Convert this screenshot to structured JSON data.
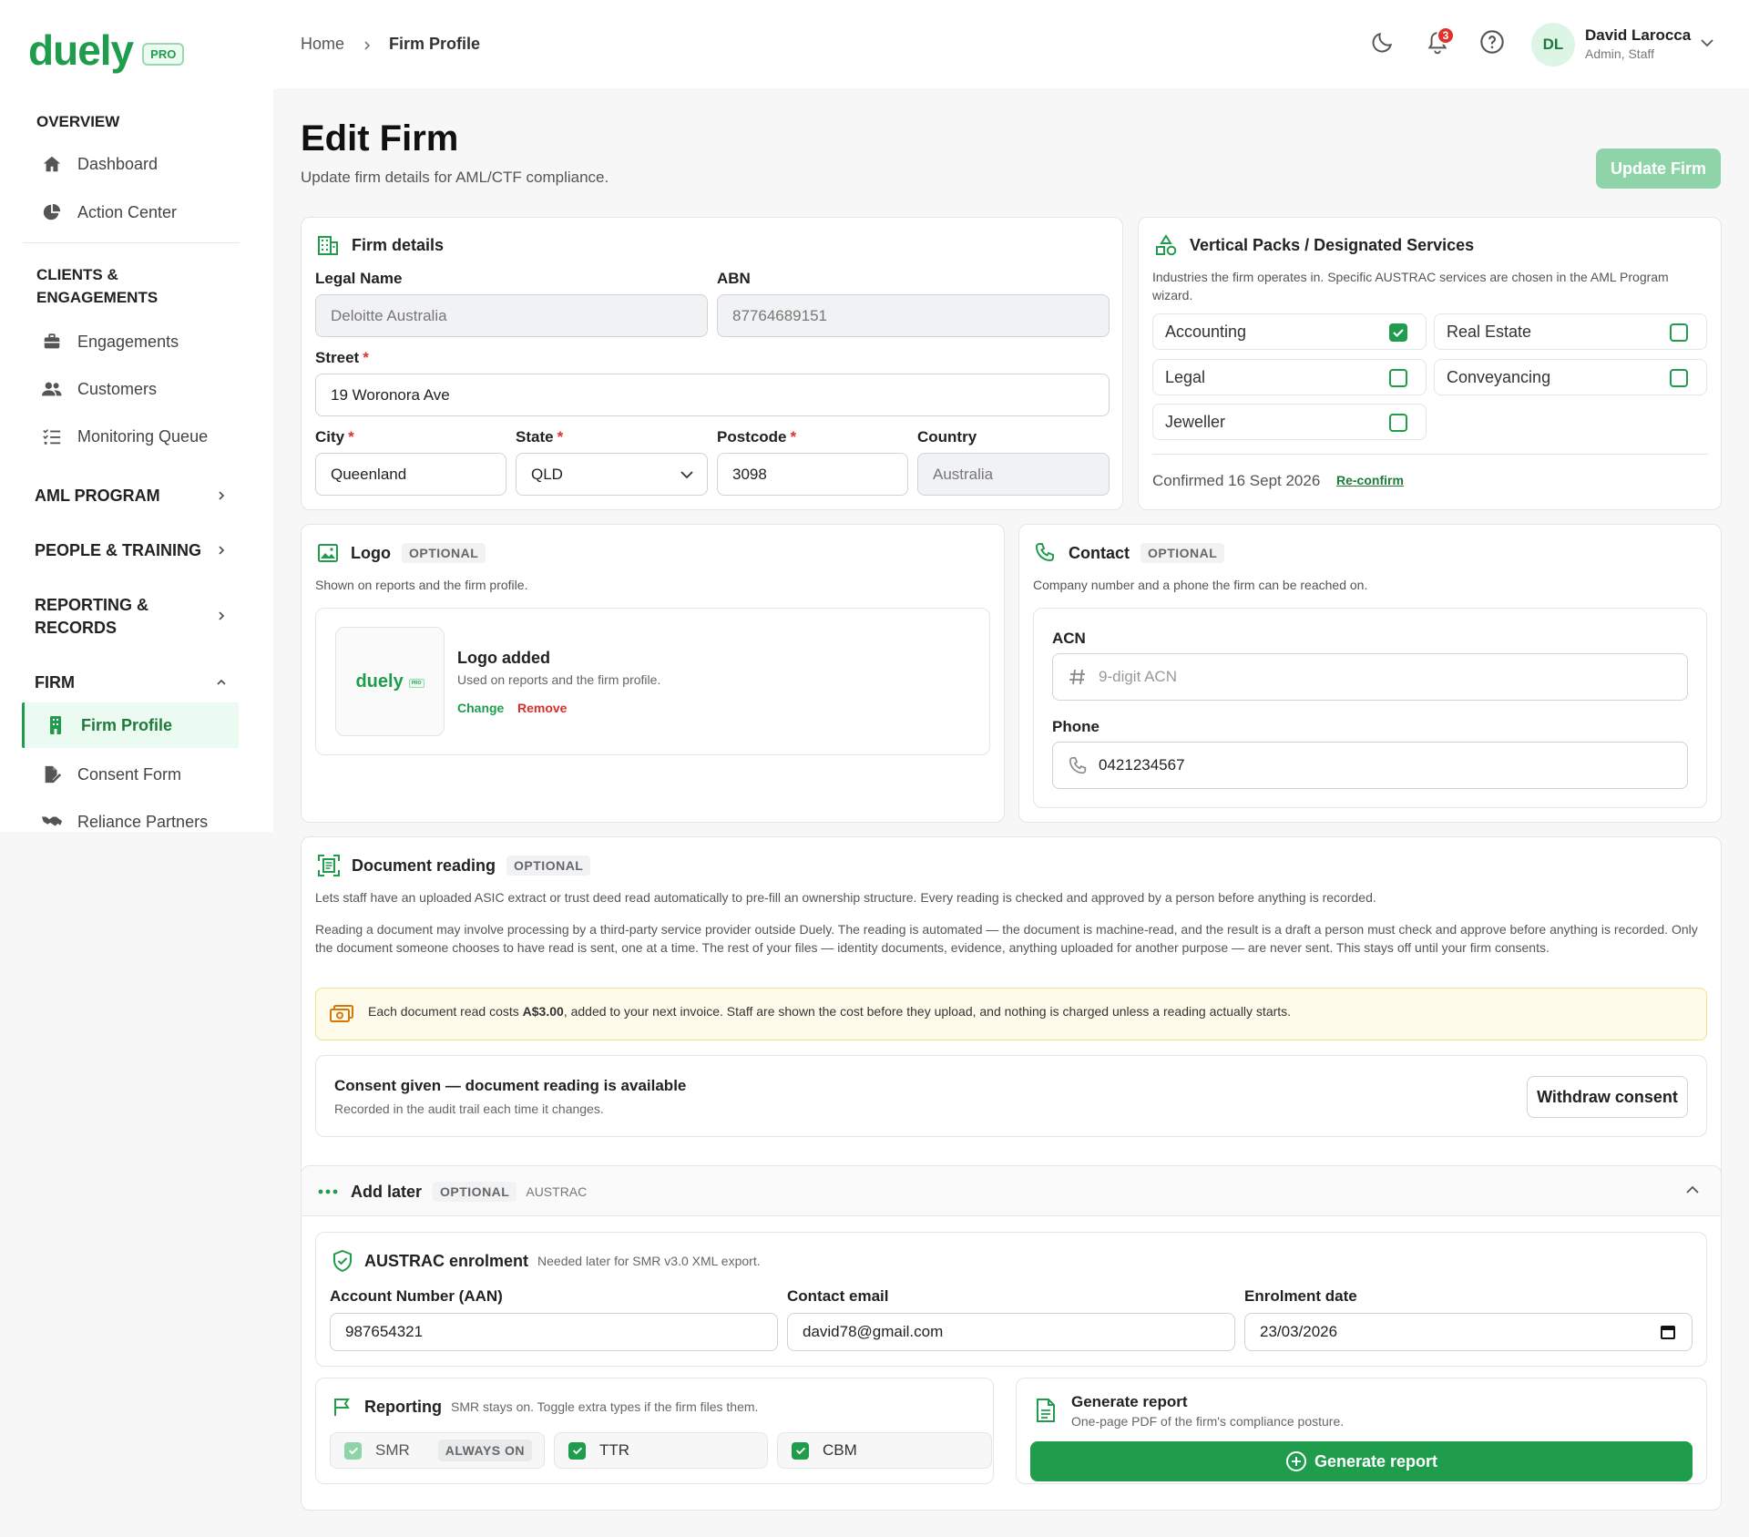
{
  "brand": {
    "name": "duely",
    "badge": "PRO"
  },
  "sidebar": {
    "sections": {
      "overview": "OVERVIEW",
      "clients": "CLIENTS &\nENGAGEMENTS",
      "aml": "AML PROGRAM",
      "people": "PEOPLE & TRAINING",
      "reporting": "REPORTING &\nRECORDS",
      "firm": "FIRM"
    },
    "items": {
      "dashboard": "Dashboard",
      "action_center": "Action Center",
      "engagements": "Engagements",
      "customers": "Customers",
      "monitoring": "Monitoring Queue",
      "firm_profile": "Firm Profile",
      "consent_form": "Consent Form",
      "reliance": "Reliance Partners"
    }
  },
  "header": {
    "breadcrumb": {
      "home": "Home",
      "current": "Firm Profile"
    },
    "notifications": "3",
    "user": {
      "initials": "DL",
      "name": "David Larocca",
      "role": "Admin, Staff"
    }
  },
  "page": {
    "title": "Edit Firm",
    "subtitle": "Update firm details for AML/CTF compliance.",
    "update_button": "Update Firm"
  },
  "firm_details": {
    "title": "Firm details",
    "legal_name_label": "Legal Name",
    "legal_name": "Deloitte Australia",
    "abn_label": "ABN",
    "abn": "87764689151",
    "street_label": "Street",
    "street": "19 Woronora Ave",
    "city_label": "City",
    "city": "Queenland",
    "state_label": "State",
    "state": "QLD",
    "postcode_label": "Postcode",
    "postcode": "3098",
    "country_label": "Country",
    "country": "Australia",
    "required_mark": "*"
  },
  "vertical": {
    "title": "Vertical Packs / Designated Services",
    "desc": "Industries the firm operates in. Specific AUSTRAC services are chosen in the AML Program wizard.",
    "options": {
      "accounting": "Accounting",
      "real_estate": "Real Estate",
      "legal": "Legal",
      "conveyancing": "Conveyancing",
      "jeweller": "Jeweller"
    },
    "checked": {
      "accounting": true,
      "real_estate": false,
      "legal": false,
      "conveyancing": false,
      "jeweller": false
    },
    "confirmed": "Confirmed 16 Sept 2026",
    "reconfirm": "Re-confirm"
  },
  "logo_card": {
    "title": "Logo",
    "optional": "OPTIONAL",
    "desc": "Shown on reports and the firm profile.",
    "added": "Logo added",
    "added_desc": "Used on reports and the firm profile.",
    "change": "Change",
    "remove": "Remove",
    "thumb_word": "duely",
    "thumb_badge": "PRO"
  },
  "contact": {
    "title": "Contact",
    "optional": "OPTIONAL",
    "desc": "Company number and a phone the firm can be reached on.",
    "acn_label": "ACN",
    "acn_placeholder": "9-digit ACN",
    "phone_label": "Phone",
    "phone": "0421234567"
  },
  "doc_reading": {
    "title": "Document reading",
    "optional": "OPTIONAL",
    "desc1": "Lets staff have an uploaded ASIC extract or trust deed read automatically to pre-fill an ownership structure. Every reading is checked and approved by a person before anything is recorded.",
    "desc2": "Reading a document may involve processing by a third-party service provider outside Duely. The reading is automated — the document is machine-read, and the result is a draft a person must check and approve before anything is recorded. Only the document someone chooses to have read is sent, one at a time. The rest of your files — identity documents, evidence, anything uploaded for another purpose — are never sent. This stays off until your firm consents.",
    "cost_pre": "Each document read costs ",
    "cost_amount": "A$3.00",
    "cost_post": ", added to your next invoice. Staff are shown the cost before they upload, and nothing is charged unless a reading actually starts.",
    "consent_title": "Consent given — document reading is available",
    "consent_sub": "Recorded in the audit trail each time it changes.",
    "withdraw": "Withdraw consent"
  },
  "add_later": {
    "title": "Add later",
    "optional": "OPTIONAL",
    "tag": "AUSTRAC",
    "austrac": {
      "title": "AUSTRAC enrolment",
      "note": "Needed later for SMR v3.0 XML export.",
      "aan_label": "Account Number (AAN)",
      "aan": "987654321",
      "email_label": "Contact email",
      "email": "david78@gmail.com",
      "date_label": "Enrolment date",
      "date": "23/03/2026"
    },
    "reporting": {
      "title": "Reporting",
      "note": "SMR stays on. Toggle extra types if the firm files them.",
      "smr": "SMR",
      "always_on": "ALWAYS ON",
      "ttr": "TTR",
      "cbm": "CBM"
    },
    "generate": {
      "title": "Generate report",
      "desc": "One-page PDF of the firm's compliance posture.",
      "button": "Generate report"
    }
  },
  "colors": {
    "brand": "#1f9d4c",
    "brand_light": "#ecfbf1",
    "disabled_button": "#8fd4a9",
    "danger": "#e0312b",
    "notice_bg": "#fffbea"
  }
}
